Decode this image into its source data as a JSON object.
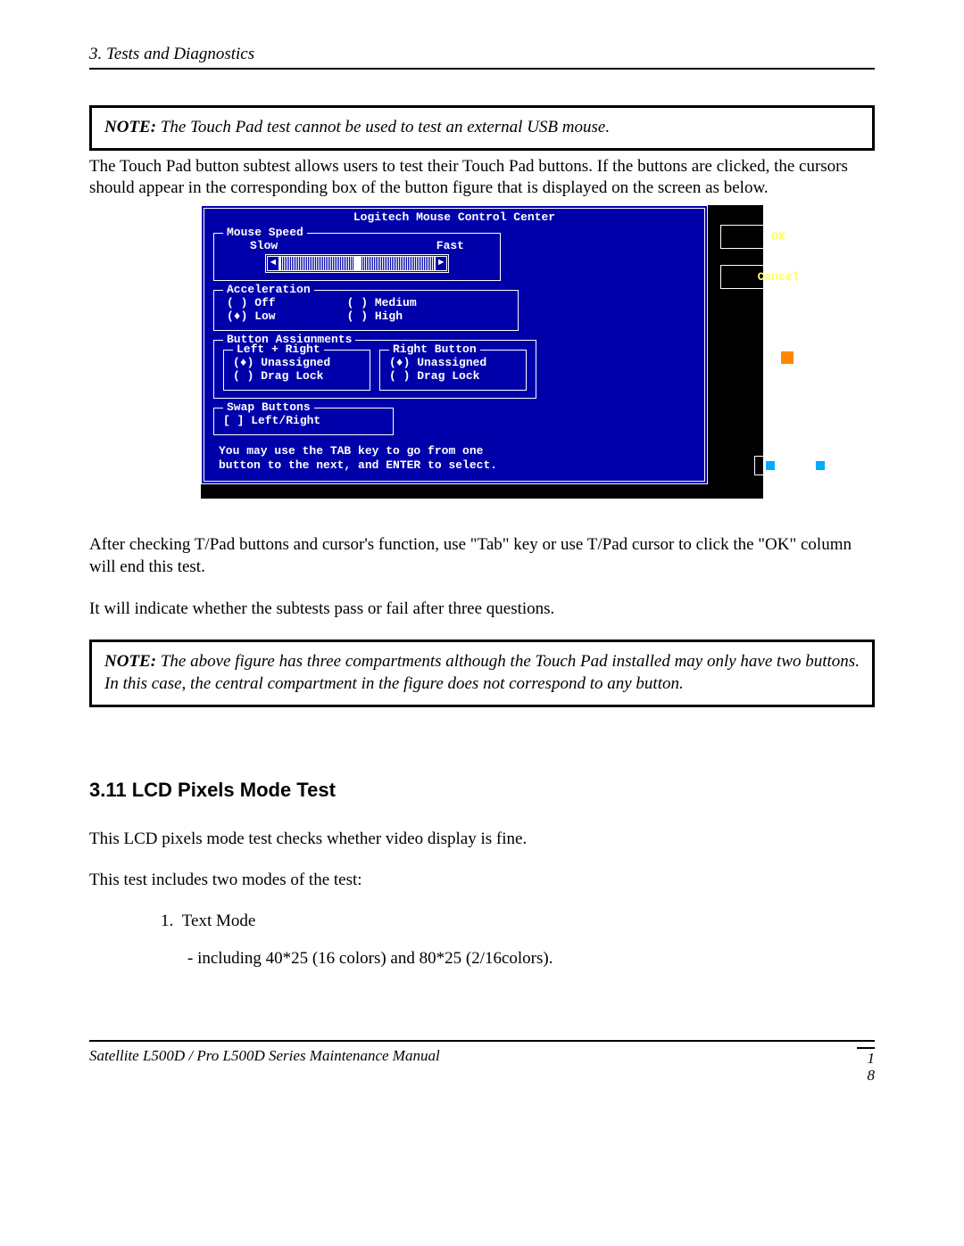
{
  "header": "3.  Tests and Diagnostics",
  "note1": {
    "prefix": "NOTE:",
    "text": "  The Touch Pad test cannot be used to test an external USB mouse."
  },
  "para1": "The Touch Pad button subtest allows users to test their Touch Pad buttons. If the buttons are clicked, the cursors should appear in the corresponding box of the button figure that is displayed on the screen as below.",
  "console": {
    "title": "Logitech Mouse Control Center",
    "mouseSpeed": {
      "label": "Mouse Speed",
      "slow": "Slow",
      "fast": "Fast"
    },
    "accel": {
      "label": "Acceleration",
      "off": "( ) Off",
      "low": "(♦) Low",
      "medium": "( ) Medium",
      "high": "( ) High"
    },
    "btnAssign": {
      "label": "Button Assignments",
      "left": {
        "label": "Left + Right",
        "opt1": "(♦) Unassigned",
        "opt2": "( ) Drag Lock"
      },
      "right": {
        "label": "Right Button",
        "opt1": "(♦) Unassigned",
        "opt2": "( ) Drag Lock"
      }
    },
    "swap": {
      "label": "Swap Buttons",
      "opt": "[ ] Left/Right"
    },
    "hint1": "You may use the TAB key to go from one",
    "hint2": "button to the next, and ENTER to select.",
    "ok": "OK",
    "cancel": "Cancel"
  },
  "para2": "After checking T/Pad buttons and cursor's function, use \"Tab\" key or use T/Pad cursor to click the \"OK\" column will end this test.",
  "para3": "It will indicate whether the subtests pass or fail after three questions.",
  "note2": {
    "prefix": "NOTE:",
    "text": "  The above figure has three compartments although the Touch Pad installed may only have two buttons. In this case, the central compartment in the figure does not correspond to any button."
  },
  "section": "3.11 LCD Pixels Mode Test",
  "para4": "This LCD pixels mode test checks whether video display is fine.",
  "para5": "This test includes two modes of the test:",
  "list1_num": "1.",
  "list1": "Text Mode",
  "list1_sub": "- including 40*25 (16 colors) and 80*25 (2/16colors).",
  "footer": "Satellite L500D / Pro L500D Series Maintenance Manual",
  "page_a": "1",
  "page_b": "8"
}
